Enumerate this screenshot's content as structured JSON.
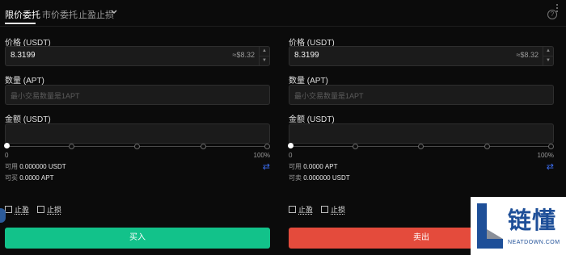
{
  "order_tabs": [
    {
      "label": "限价委托",
      "active": true
    },
    {
      "label": "市价委托",
      "active": false
    },
    {
      "label": "止盈止损",
      "active": false
    }
  ],
  "help_symbol": "?",
  "buy": {
    "price_label": "价格 (USDT)",
    "price_value": "8.3199",
    "price_approx": "≈$8.32",
    "qty_label": "数量 (APT)",
    "qty_placeholder": "最小交易数量是1APT",
    "amount_label": "金额 (USDT)",
    "amount_value": "",
    "slider_min": "0",
    "slider_max": "100%",
    "slider_percent": 0,
    "available_label": "可用",
    "available_value": "0.000000 USDT",
    "max_label": "可买",
    "max_value": "0.0000 APT",
    "tp_label": "止盈",
    "sl_label": "止损",
    "tp_checked": false,
    "sl_checked": false,
    "action_label": "买入",
    "action_color": "#12c28a"
  },
  "sell": {
    "price_label": "价格 (USDT)",
    "price_value": "8.3199",
    "price_approx": "≈$8.32",
    "qty_label": "数量 (APT)",
    "qty_placeholder": "最小交易数量是1APT",
    "amount_label": "金额 (USDT)",
    "amount_value": "",
    "slider_min": "0",
    "slider_max": "100%",
    "slider_percent": 0,
    "available_label": "可用",
    "available_value": "0.0000 APT",
    "max_label": "可卖",
    "max_value": "0.000000 USDT",
    "tp_label": "止盈",
    "sl_label": "止损",
    "tp_checked": false,
    "sl_checked": false,
    "action_label": "卖出",
    "action_color": "#e44b3c"
  },
  "icons": {
    "swap": "swap-arrows-icon",
    "stepper_up": "triangle-up-icon",
    "stepper_down": "triangle-down-icon",
    "dropdown": "chevron-down-icon",
    "more": "more-vertical-icon",
    "help": "help-circle-icon"
  },
  "watermark": {
    "brand": "链懂",
    "domain": "NEATDOWN.COM",
    "color": "#1e4f98"
  }
}
